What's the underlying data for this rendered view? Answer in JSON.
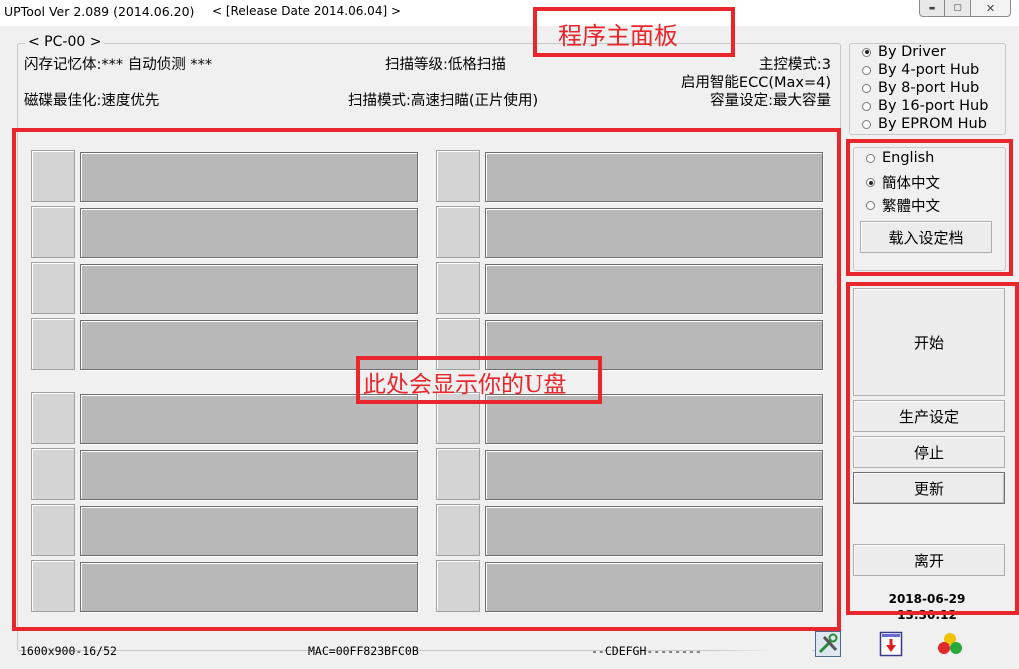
{
  "window": {
    "title": "UPTool Ver 2.089 (2014.06.20)",
    "release": "< [Release Date 2014.06.04] >",
    "buttons": {
      "minimize": "▬",
      "maximize": "▢",
      "close": "✕"
    }
  },
  "pc_panel": {
    "legend": "< PC-00 >",
    "flash_memory": "闪存记忆体:*** 自动侦测 ***",
    "scan_level": "扫描等级:低格扫描",
    "controller_mode": "主控模式:3",
    "smart_ecc": "启用智能ECC(Max=4)",
    "disk_optimize": "磁碟最佳化:速度优先",
    "scan_mode": "扫描模式:高速扫瞄(正片使用)",
    "capacity": "容量设定:最大容量"
  },
  "hub_options": [
    {
      "label": "By Driver",
      "selected": true
    },
    {
      "label": "By 4-port Hub",
      "selected": false
    },
    {
      "label": "By 8-port Hub",
      "selected": false
    },
    {
      "label": "By 16-port Hub",
      "selected": false
    },
    {
      "label": "By EPROM Hub",
      "selected": false
    }
  ],
  "languages": [
    {
      "label": "English",
      "selected": false
    },
    {
      "label": "簡体中文",
      "selected": true
    },
    {
      "label": "繁體中文",
      "selected": false
    }
  ],
  "load_config_button": "载入设定档",
  "actions": {
    "start": "开始",
    "production_settings": "生产设定",
    "stop": "停止",
    "update": "更新",
    "exit": "离开"
  },
  "datetime": {
    "date": "2018-06-29",
    "time": "13:30:12"
  },
  "status_bar": {
    "resolution": "1600x900-16/52",
    "mac": "MAC=00FF823BFC0B",
    "drives": "--CDEFGH--------"
  },
  "annotations": {
    "main_panel": "程序主面板",
    "udisk_area": "此处会显示你的U盘"
  },
  "tool_icons": [
    "tools-icon",
    "download-icon",
    "color-balls-icon"
  ],
  "colors": {
    "annotation_red": "#e8262b",
    "bar_gray": "#b8b8b8",
    "window_bg": "#f0f0f0"
  }
}
